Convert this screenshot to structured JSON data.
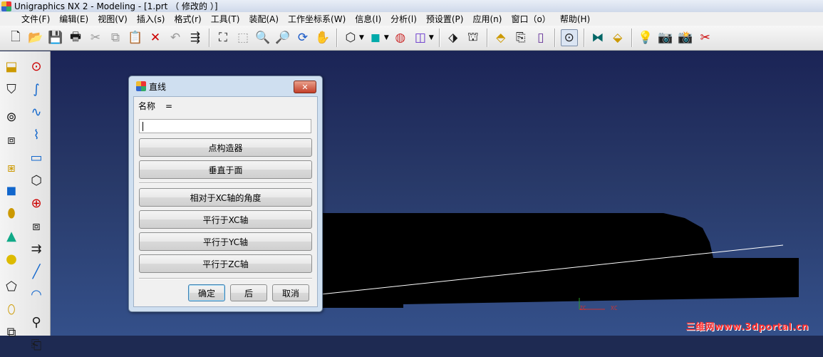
{
  "window": {
    "title": "Unigraphics NX 2 - Modeling - [1.prt （ 修改的 ）]"
  },
  "menu": [
    "文件(F)",
    "编辑(E)",
    "视图(V)",
    "插入(s)",
    "格式(r)",
    "工具(T)",
    "装配(A)",
    "工作坐标系(W)",
    "信息(I)",
    "分析(l)",
    "预设置(P)",
    "应用(n)",
    "窗口（o）",
    "帮助(H)"
  ],
  "dialog": {
    "title": "直线",
    "name_label": "名称",
    "name_eq": "=",
    "name_value": "",
    "buttons": {
      "point_constructor": "点构造器",
      "perpendicular_to_face": "垂直于面",
      "angle_to_xc": "相对于XC轴的角度",
      "parallel_xc": "平行于XC轴",
      "parallel_yc": "平行于YC轴",
      "parallel_zc": "平行于ZC轴"
    },
    "footer": {
      "ok": "确定",
      "back": "后",
      "cancel": "取消"
    }
  },
  "graphics": {
    "axis_labels": {
      "zc": "ZC",
      "xc": "XC"
    },
    "watermark": "三维网www.3dportal.cn"
  },
  "colors": {
    "viewport_top": "#1b2456",
    "viewport_bottom": "#34508a",
    "model_fill": "#000000",
    "curve_line": "#ffffff",
    "watermark": "#ff3030"
  }
}
